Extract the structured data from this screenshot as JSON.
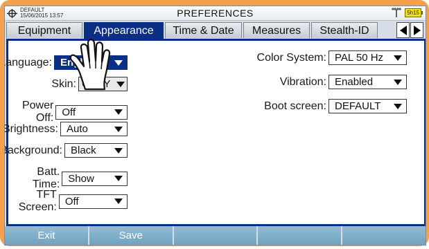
{
  "status_bar": {
    "profile": "DEFAULT",
    "datetime": "15/06/2015 13:57",
    "title": "PREFERENCES",
    "battery": "5h15",
    "icons": [
      "target-icon",
      "antenna-icon",
      "battery-icon"
    ]
  },
  "tabs": [
    {
      "label": "Equipment",
      "active": false
    },
    {
      "label": "Appearance",
      "active": true
    },
    {
      "label": "Time & Date",
      "active": false
    },
    {
      "label": "Measures",
      "active": false
    },
    {
      "label": "Stealth-ID",
      "active": false
    }
  ],
  "left_settings": [
    {
      "label": "Language:",
      "value": "English",
      "selected": true
    },
    {
      "label": "Skin:",
      "value": "GRAY"
    },
    {
      "label": "Power Off:",
      "value": "Off"
    },
    {
      "label": "Brightness:",
      "value": "Auto"
    },
    {
      "label": "Background:",
      "value": "Black"
    },
    {
      "label": "Batt. Time:",
      "value": "Show"
    },
    {
      "label": "TFT Screen:",
      "value": "Off"
    }
  ],
  "right_settings": [
    {
      "label": "Color System:",
      "value": "PAL 50 Hz"
    },
    {
      "label": "Vibration:",
      "value": "Enabled"
    },
    {
      "label": "Boot screen:",
      "value": "DEFAULT"
    }
  ],
  "softkeys": [
    "Exit",
    "Save",
    "",
    "",
    ""
  ],
  "colors": {
    "device_frame": "#f5a14c",
    "accent": "#0c2f86",
    "softkey": "#7fb0cb",
    "battery": "#f4e20a"
  }
}
